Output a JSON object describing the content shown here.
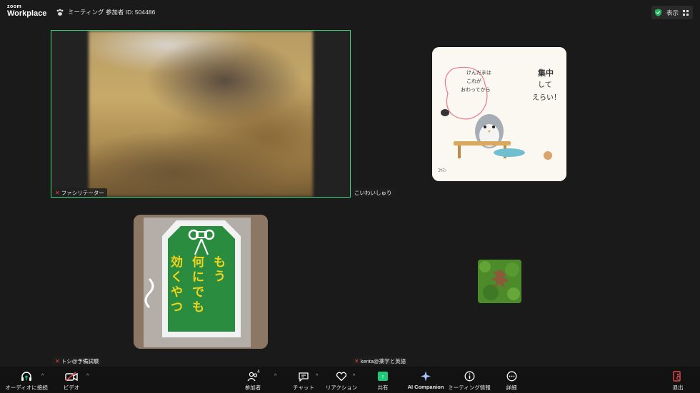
{
  "app": {
    "logo_small": "zoom",
    "logo_big": "Workplace",
    "meeting_title": "ミーティング 参加者 ID: 504486",
    "view_label": "表示"
  },
  "participants": [
    {
      "name": "ファシリテーター",
      "muted": true,
      "active_speaker": true
    },
    {
      "name": "こいわいしゅり",
      "muted": false
    },
    {
      "name": "トシ@予備試験",
      "muted": true
    },
    {
      "name": "kenta@薬学と英語",
      "muted": true
    }
  ],
  "toolbar": {
    "audio": "オーディオに接続",
    "video": "ビデオ",
    "participants": "参加者",
    "participants_count": "4",
    "chat": "チャット",
    "reactions": "リアクション",
    "share": "共有",
    "ai": "AI Companion",
    "info": "ミーティング情報",
    "more": "詳細",
    "leave": "退出"
  },
  "colors": {
    "active_border": "#38d97a",
    "share_green": "#1ec97a",
    "leave_red": "#e34b4b",
    "background": "#1a1a1a"
  }
}
